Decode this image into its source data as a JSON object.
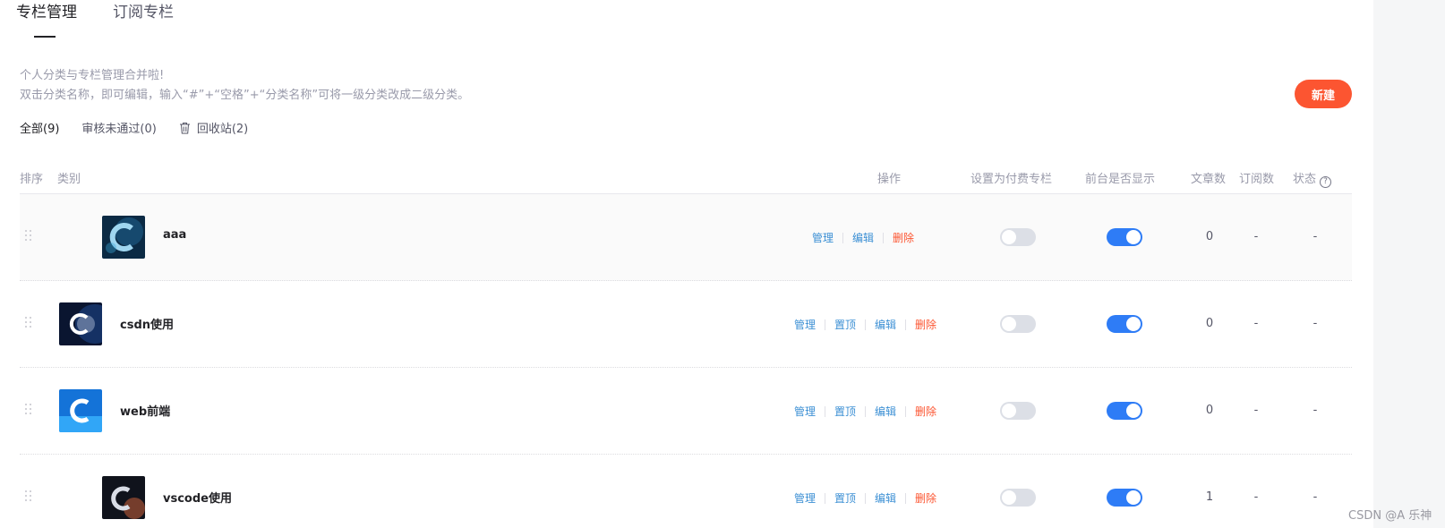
{
  "tabs": [
    {
      "label": "专栏管理",
      "active": true
    },
    {
      "label": "订阅专栏",
      "active": false
    }
  ],
  "notes": {
    "line1": "个人分类与专栏管理合并啦!",
    "line2": "双击分类名称，即可编辑，输入“#”+“空格”+“分类名称”可将一级分类改成二级分类。"
  },
  "new_button": "新建",
  "filters": {
    "all": "全部(9)",
    "rejected": "审核未通过(0)",
    "recycle": "回收站(2)"
  },
  "columns": {
    "order": "排序",
    "category": "类别",
    "actions": "操作",
    "paid": "设置为付费专栏",
    "visible": "前台是否显示",
    "articles": "文章数",
    "subscriptions": "订阅数",
    "status": "状态"
  },
  "action_labels": {
    "manage": "管理",
    "pin": "置顶",
    "edit": "编辑",
    "delete": "删除"
  },
  "rows": [
    {
      "name": "aaa",
      "paid": false,
      "visible": true,
      "articles": "0",
      "subscriptions": "-",
      "status": "-"
    },
    {
      "name": "csdn使用",
      "paid": false,
      "visible": true,
      "articles": "0",
      "subscriptions": "-",
      "status": "-"
    },
    {
      "name": "web前端",
      "paid": false,
      "visible": true,
      "articles": "0",
      "subscriptions": "-",
      "status": "-"
    },
    {
      "name": "vscode使用",
      "paid": false,
      "visible": true,
      "articles": "1",
      "subscriptions": "-",
      "status": "-"
    }
  ],
  "colors": {
    "accent": "#fc5531",
    "link": "#3b8fd4",
    "switch_on": "#2e7cf6",
    "switch_off": "#dcdfe6"
  },
  "watermark": "CSDN @A 乐神"
}
